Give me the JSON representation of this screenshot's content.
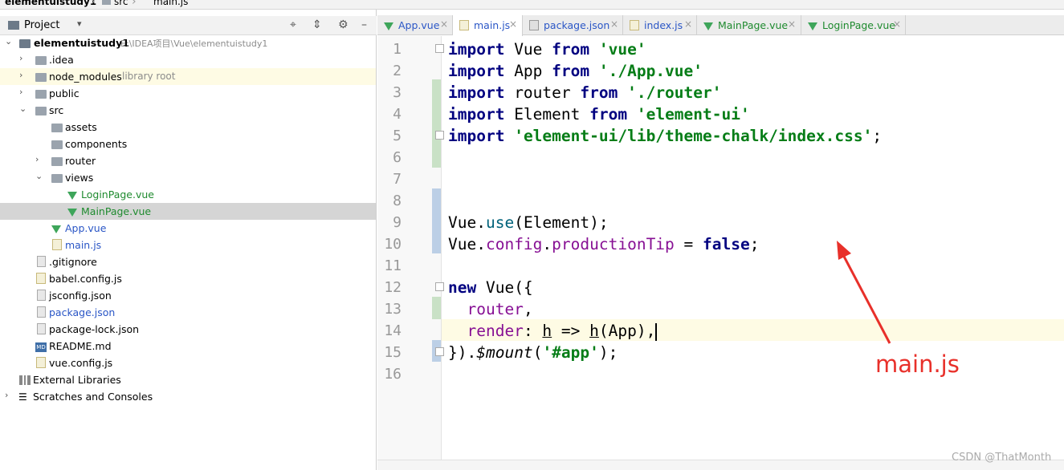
{
  "breadcrumb": [
    "elementuistudy1",
    "src",
    "main.js"
  ],
  "project_panel": {
    "title": "Project",
    "tree": [
      {
        "label": "elementuistudy1",
        "hint": "E:\\IDEA项目\\Vue\\elementuistudy1"
      },
      {
        "label": ".idea"
      },
      {
        "label": "node_modules",
        "hint": "library root"
      },
      {
        "label": "public"
      },
      {
        "label": "src"
      },
      {
        "label": "assets"
      },
      {
        "label": "components"
      },
      {
        "label": "router"
      },
      {
        "label": "views"
      },
      {
        "label": "LoginPage.vue"
      },
      {
        "label": "MainPage.vue"
      },
      {
        "label": "App.vue"
      },
      {
        "label": "main.js"
      },
      {
        "label": ".gitignore"
      },
      {
        "label": "babel.config.js"
      },
      {
        "label": "jsconfig.json"
      },
      {
        "label": "package.json"
      },
      {
        "label": "package-lock.json"
      },
      {
        "label": "README.md"
      },
      {
        "label": "vue.config.js"
      },
      {
        "label": "External Libraries"
      },
      {
        "label": "Scratches and Consoles"
      }
    ]
  },
  "tabs": [
    {
      "label": "App.vue",
      "icon": "vue-icon"
    },
    {
      "label": "main.js",
      "icon": "js-file-icon",
      "active": true
    },
    {
      "label": "package.json",
      "icon": "json-file-icon"
    },
    {
      "label": "index.js",
      "icon": "js-file-icon"
    },
    {
      "label": "MainPage.vue",
      "icon": "vue-icon"
    },
    {
      "label": "LoginPage.vue",
      "icon": "vue-icon"
    }
  ],
  "editor": {
    "line_numbers": [
      "1",
      "2",
      "3",
      "4",
      "5",
      "6",
      "7",
      "8",
      "9",
      "10",
      "11",
      "12",
      "13",
      "14",
      "15",
      "16"
    ],
    "lines": [
      "import Vue from 'vue'",
      "import App from './App.vue'",
      "import router from './router'",
      "import Element from 'element-ui'",
      "import 'element-ui/lib/theme-chalk/index.css';",
      "",
      "",
      "",
      "Vue.use(Element);",
      "Vue.config.productionTip = false;",
      "",
      "new Vue({",
      "  router,",
      "  render: h => h(App),",
      "}).$mount('#app');",
      ""
    ],
    "current_line": 14
  },
  "annotation": {
    "label": "main.js",
    "color": "#e8302a"
  },
  "watermark": "CSDN @ThatMonth"
}
